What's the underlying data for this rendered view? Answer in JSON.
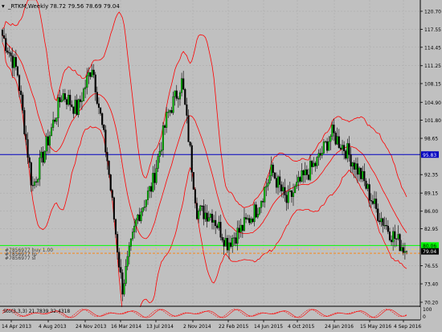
{
  "window": {
    "symbol_header": "_RTKM,Weekly",
    "ohlc_values": "78.72 79.56 78.69 79.04"
  },
  "price_axis": {
    "labels": [
      "120.70",
      "117.55",
      "114.45",
      "111.25",
      "108.15",
      "104.90",
      "101.80",
      "98.65",
      "95.83",
      "92.35",
      "89.15",
      "86.00",
      "82.95",
      "80.06",
      "79.04",
      "76.55",
      "73.40",
      "70.20"
    ],
    "highlight": {
      "blue_line_value": "95.83",
      "green_line_value": "80.06",
      "current_price": "79.04"
    }
  },
  "time_axis": {
    "labels": [
      "14 Apr 2013",
      "4 Aug 2013",
      "24 Nov 2013",
      "16 Mar 2014",
      "13 Jul 2014",
      "2 Nov 2014",
      "22 Feb 2015",
      "14 Jun 2015",
      "4 Oct 2015",
      "24 Jan 2016",
      "15 May 2016",
      "4 Sep 2016"
    ]
  },
  "orders": {
    "buy_label": "#7856977 buy 1.00",
    "order_label_2": "#7856977 tp",
    "order_label_3": "#7856977 sl"
  },
  "indicator": {
    "label": "Sto(3,3,3) 21.7839 32.4318",
    "scale_top": "100",
    "scale_bottom": "0"
  },
  "colors": {
    "background": "#c0c0c0",
    "bull_candle": "#00c000",
    "bear_candle": "#000000",
    "bands": "#ff0000",
    "blue_line": "#0000c0",
    "green_line": "#00ff00",
    "order_line": "#ff8000",
    "current_price_box": "#000000"
  },
  "chart_data": {
    "type": "candlestick",
    "y_axis_range": [
      70.2,
      120.7
    ],
    "price_levels": {
      "blue_line": 95.83,
      "green_line": 80.06,
      "current": 79.04
    },
    "closes_approx": [
      116.5,
      110.2,
      90.0,
      98.0,
      106.5,
      103.5,
      111.5,
      95.0,
      72.5,
      85.0,
      90.5,
      102.5,
      108.5,
      86.0,
      85.5,
      80.5,
      83.0,
      86.5,
      93.0,
      87.5,
      91.5,
      94.5,
      99.5,
      96.5,
      92.0,
      86.0,
      82.0,
      79.04
    ]
  }
}
